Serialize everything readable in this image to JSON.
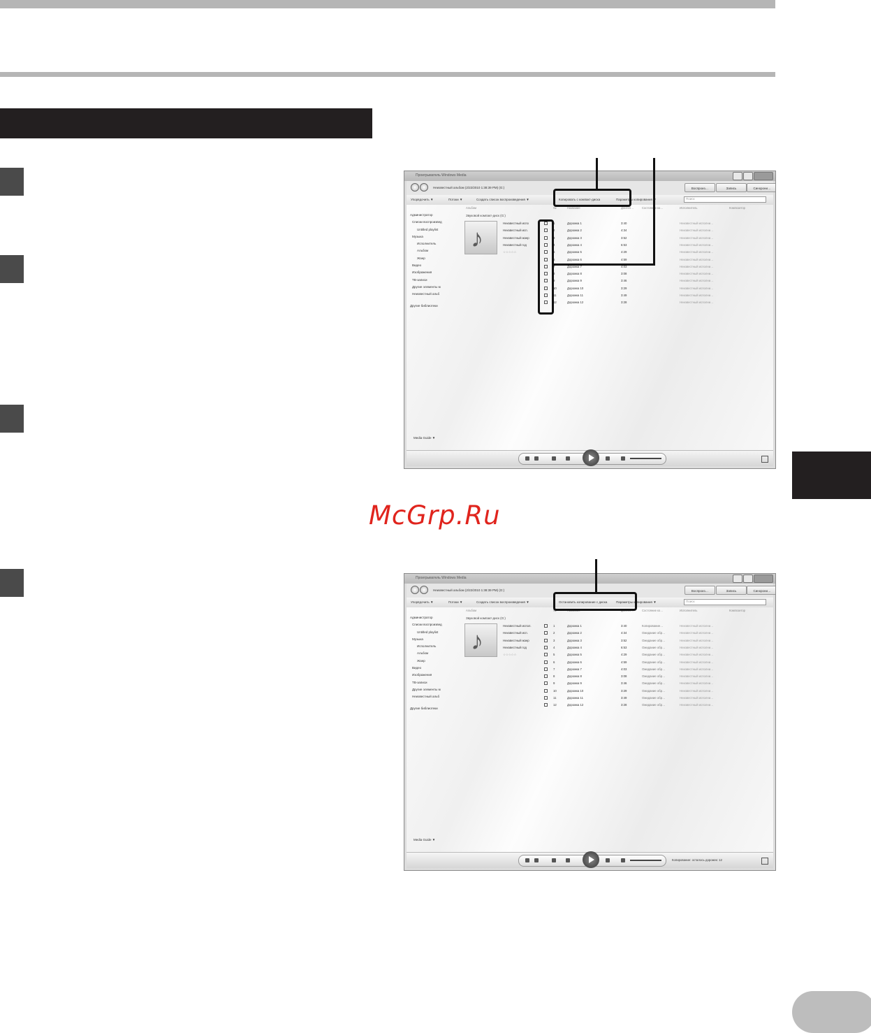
{
  "watermark": "McGrp.Ru",
  "wmp1": {
    "title": "Проигрыватель Windows Media",
    "breadcrumb": "Неизвестный альбом (2/22/2010 1:38:39 PM) (G:)",
    "buttons": [
      "Воспроиз…",
      "Запись",
      "Синхрони…"
    ],
    "toolbar": [
      "Упорядочить ▼",
      "Потоки ▼",
      "Создать список воспроизведения ▼",
      "Копировать с компакт-диска",
      "Параметры копирования ▼"
    ],
    "search_placeholder": "Поиск",
    "nav": [
      "Администратор",
      "Списки воспроизвед",
      "Untitled playlist",
      "Музыка",
      "Исполнитель",
      "Альбом",
      "Жанр",
      "Видео",
      "Изображения",
      "ТВ-записи",
      "Другие элементы м",
      "Неизвестный альб"
    ],
    "other_libraries": "Другие библиотеки",
    "media_guide": "Media Guide ▼",
    "album_column": "Альбом",
    "album_title": "Звуковой компакт-диск (G:)",
    "album_meta": [
      "Неизвестный испо",
      "Неизвестный исп.",
      "Неизвестный жанр",
      "Неизвестный год"
    ],
    "rating": "☆☆☆☆☆",
    "column_headers": [
      "№",
      "Название",
      "Длител…",
      "Состояние ко…",
      "Исполнитель",
      "Композитор"
    ],
    "track_numbers": [
      "1",
      "2",
      "3",
      "4",
      "5",
      "6",
      "7",
      "8",
      "9",
      "10",
      "11",
      "12"
    ],
    "track_titles": [
      "Дорожка 1",
      "Дорожка 2",
      "Дорожка 3",
      "Дорожка 4",
      "Дорожка 5",
      "Дорожка 6",
      "Дорожка 7",
      "Дорожка 8",
      "Дорожка 9",
      "Дорожка 10",
      "Дорожка 11",
      "Дорожка 12"
    ],
    "track_lengths": [
      "3:40",
      "4:34",
      "3:52",
      "6:53",
      "4:29",
      "4:59",
      "4:03",
      "3:08",
      "3:46",
      "3:29",
      "3:49",
      "3:28"
    ],
    "track_status": [],
    "track_artist": "Неизвестный исполни…",
    "copy_status": ""
  },
  "wmp2": {
    "title": "Проигрыватель Windows Media",
    "breadcrumb": "Неизвестный альбом (2/22/2010 1:38:39 PM) (G:)",
    "buttons": [
      "Воспроиз…",
      "Запись",
      "Синхрони…"
    ],
    "toolbar": [
      "Упорядочить ▼",
      "Потоки ▼",
      "Создать список воспроизведения ▼",
      "Остановить копирование с диска",
      "Параметры копирования ▼"
    ],
    "search_placeholder": "Поиск",
    "nav": [
      "Администратор",
      "Списки воспроизвед",
      "Untitled playlist",
      "Музыка",
      "Исполнитель",
      "Альбом",
      "Жанр",
      "Видео",
      "Изображения",
      "ТВ-записи",
      "Другие элементы м",
      "Неизвестный альб"
    ],
    "other_libraries": "Другие библиотеки",
    "media_guide": "Media Guide ▼",
    "album_column": "Альбом",
    "album_title": "Звуковой компакт-диск (G:)",
    "album_meta": [
      "Неизвестный испол.",
      "Неизвестный исп.",
      "Неизвестный жанр",
      "Неизвестный год"
    ],
    "rating": "☆☆☆☆☆",
    "column_headers": [
      "№",
      "Название",
      "Длител…",
      "Состояние ко…",
      "Исполнитель",
      "Композитор"
    ],
    "track_numbers": [
      "1",
      "2",
      "3",
      "4",
      "5",
      "6",
      "7",
      "8",
      "9",
      "10",
      "11",
      "12"
    ],
    "track_titles": [
      "Дорожка 1",
      "Дорожка 2",
      "Дорожка 3",
      "Дорожка 4",
      "Дорожка 5",
      "Дорожка 6",
      "Дорожка 7",
      "Дорожка 8",
      "Дорожка 9",
      "Дорожка 10",
      "Дорожка 11",
      "Дорожка 12"
    ],
    "track_lengths": [
      "3:40",
      "4:34",
      "3:52",
      "6:53",
      "4:29",
      "4:59",
      "4:03",
      "3:08",
      "3:46",
      "3:29",
      "3:49",
      "3:28"
    ],
    "track_status": [
      "Копирование…",
      "Ожидание обр…",
      "Ожидание обр…",
      "Ожидание обр…",
      "Ожидание обр…",
      "Ожидание обр…",
      "Ожидание обр…",
      "Ожидание обр…",
      "Ожидание обр…",
      "Ожидание обр…",
      "Ожидание обр…",
      "Ожидание обр…"
    ],
    "track_artist": "Неизвестный исполни…",
    "copy_status": "Копирование: осталось дорожек: 12"
  }
}
